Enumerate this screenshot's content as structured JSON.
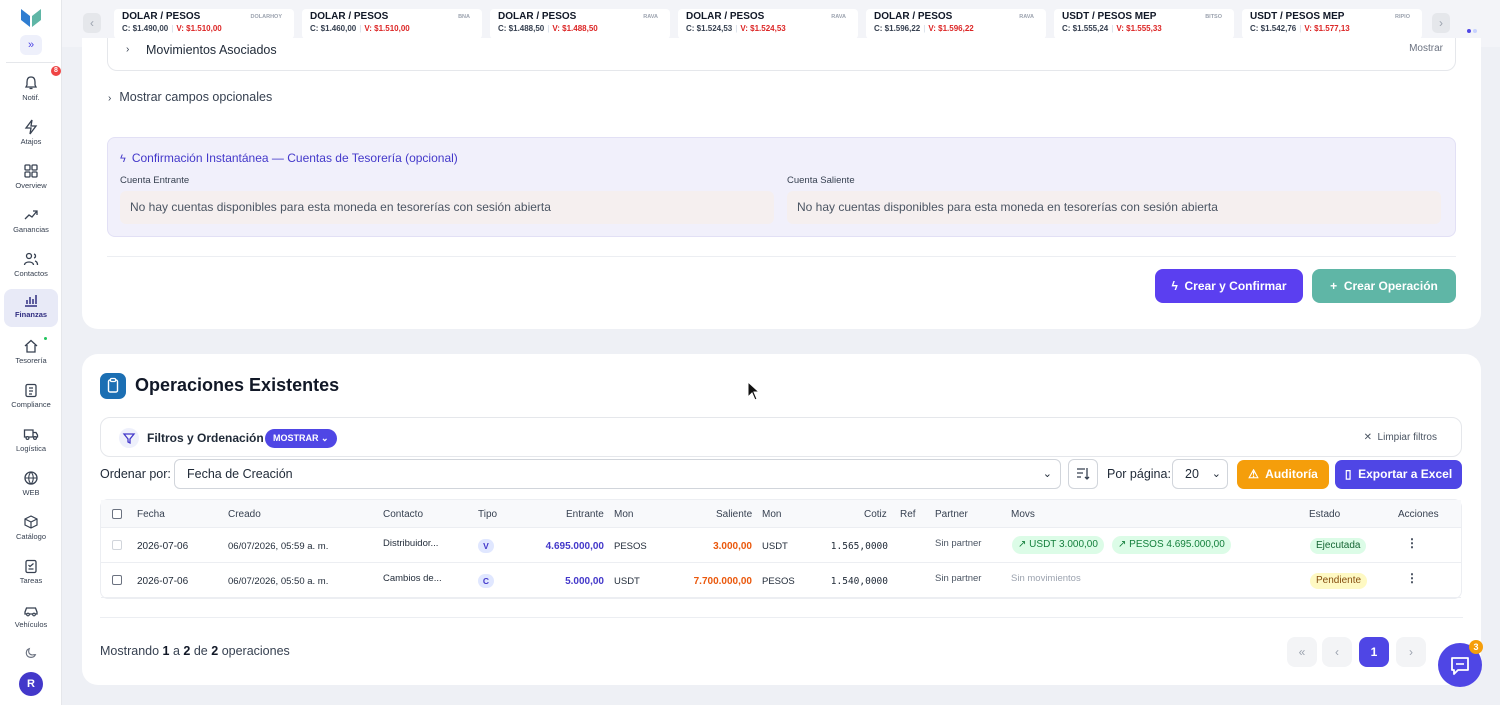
{
  "sidebar": {
    "notif_badge": "8",
    "avatar": "R",
    "items": [
      {
        "label": "Notif.",
        "icon": "bell-icon"
      },
      {
        "label": "Atajos",
        "icon": "bolt-icon"
      },
      {
        "label": "Overview",
        "icon": "grid-icon"
      },
      {
        "label": "Ganancias",
        "icon": "trend-icon"
      },
      {
        "label": "Contactos",
        "icon": "users-icon"
      },
      {
        "label": "Finanzas",
        "icon": "chart-icon"
      },
      {
        "label": "Tesorería",
        "icon": "home-icon"
      },
      {
        "label": "Compliance",
        "icon": "clipboard-icon"
      },
      {
        "label": "Logística",
        "icon": "truck-icon"
      },
      {
        "label": "WEB",
        "icon": "globe-icon"
      },
      {
        "label": "Catálogo",
        "icon": "box-icon"
      },
      {
        "label": "Tareas",
        "icon": "tasks-icon"
      },
      {
        "label": "Vehículos",
        "icon": "car-icon"
      }
    ],
    "active": "Finanzas"
  },
  "ticker": [
    {
      "pair": "DOLAR / PESOS",
      "source": "DOLARHOY",
      "c": "C: $1.490,00",
      "v": "V: $1.510,00"
    },
    {
      "pair": "DOLAR / PESOS",
      "source": "BNA",
      "c": "C: $1.460,00",
      "v": "V: $1.510,00"
    },
    {
      "pair": "DOLAR / PESOS",
      "source": "RAVA",
      "c": "C: $1.488,50",
      "v": "V: $1.488,50"
    },
    {
      "pair": "DOLAR / PESOS",
      "source": "RAVA",
      "c": "C: $1.524,53",
      "v": "V: $1.524,53"
    },
    {
      "pair": "DOLAR / PESOS",
      "source": "RAVA",
      "c": "C: $1.596,22",
      "v": "V: $1.596,22"
    },
    {
      "pair": "USDT / PESOS MEP",
      "source": "BITSO",
      "c": "C: $1.555,24",
      "v": "V: $1.555,33"
    },
    {
      "pair": "USDT / PESOS MEP",
      "source": "RIPIO",
      "c": "C: $1.542,76",
      "v": "V: $1.577,13"
    }
  ],
  "form": {
    "movimientos_title": "Movimientos Asociados",
    "movimientos_toggle": "Mostrar",
    "optional_fields": "Mostrar campos opcionales",
    "confirm_title": "Confirmación Instantánea — Cuentas de Tesorería (opcional)",
    "cuenta_entrante_label": "Cuenta Entrante",
    "cuenta_entrante_msg": "No hay cuentas disponibles para esta moneda en tesorerías con sesión abierta",
    "cuenta_saliente_label": "Cuenta Saliente",
    "cuenta_saliente_msg": "No hay cuentas disponibles para esta moneda en tesorerías con sesión abierta",
    "btn_create_confirm": "Crear y Confirmar",
    "btn_create_op": "Crear Operación"
  },
  "operations": {
    "title": "Operaciones Existentes",
    "filters_title": "Filtros y Ordenación",
    "filters_toggle": "MOSTRAR",
    "clear_filters": "Limpiar filtros",
    "order_by_label": "Ordenar por:",
    "order_by_value": "Fecha de Creación",
    "per_page_label": "Por página:",
    "per_page_value": "20",
    "btn_audit": "Auditoría",
    "btn_export": "Exportar a Excel",
    "columns": [
      "Fecha",
      "Creado",
      "Contacto",
      "Tipo",
      "Entrante",
      "Mon",
      "Saliente",
      "Mon",
      "Cotiz",
      "Ref",
      "Partner",
      "Movs",
      "Estado",
      "Acciones"
    ],
    "rows": [
      {
        "fecha": "2026-07-06",
        "creado": "06/07/2026, 05:59 a. m.",
        "contacto": "Distribuidor...",
        "tipo": "V",
        "entrante": "4.695.000,00",
        "mon_in": "PESOS",
        "saliente": "3.000,00",
        "mon_out": "USDT",
        "cotiz": "1.565,0000",
        "ref": "",
        "partner": "Sin partner",
        "movs": [
          "USDT 3.000,00",
          "PESOS 4.695.000,00"
        ],
        "estado": "Ejecutada"
      },
      {
        "fecha": "2026-07-06",
        "creado": "06/07/2026, 05:50 a. m.",
        "contacto": "Cambios de...",
        "tipo": "C",
        "entrante": "5.000,00",
        "mon_in": "USDT",
        "saliente": "7.700.000,00",
        "mon_out": "PESOS",
        "cotiz": "1.540,0000",
        "ref": "",
        "partner": "Sin partner",
        "movs_text": "Sin movimientos",
        "estado": "Pendiente"
      }
    ],
    "footer_prefix": "Mostrando",
    "footer_from": "1",
    "footer_a": "a",
    "footer_to": "2",
    "footer_de": "de",
    "footer_total": "2",
    "footer_suffix": "operaciones",
    "current_page": "1"
  },
  "chat_badge": "3",
  "colors": {
    "primary": "#4f46e5",
    "accent_teal": "#5fb6a6",
    "audit": "#f59e0b"
  }
}
